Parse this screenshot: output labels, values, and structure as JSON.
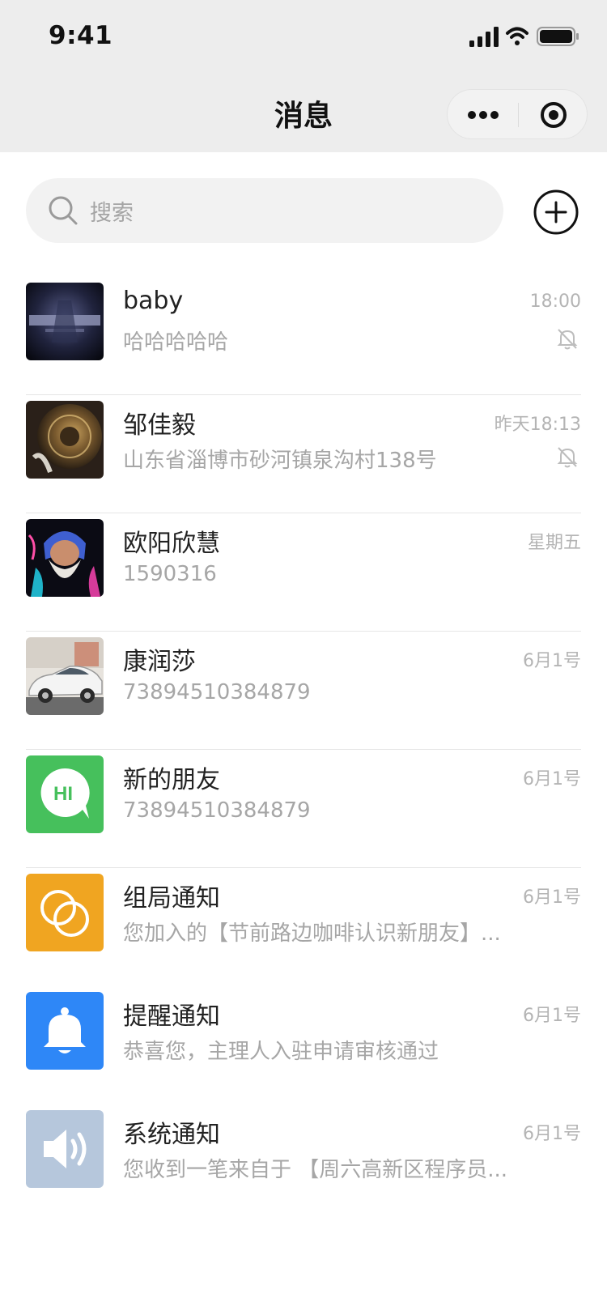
{
  "status_bar": {
    "time": "9:41"
  },
  "nav": {
    "title": "消息",
    "more_icon": "more-dots-icon",
    "close_icon": "target-circle-icon"
  },
  "search": {
    "placeholder": "搜索",
    "icon": "search-icon"
  },
  "add_button": {
    "icon": "plus-circle-icon"
  },
  "conversations": [
    {
      "name": "baby",
      "preview": "哈哈哈哈哈",
      "time": "18:00",
      "muted": true,
      "avatar": "avengers-poster"
    },
    {
      "name": "邹佳毅",
      "preview": "山东省淄博市砂河镇泉沟村138号",
      "time": "昨天18:13",
      "muted": true,
      "avatar": "clockwork-photo"
    },
    {
      "name": "欧阳欣慧",
      "preview": "1590316",
      "time": "星期五",
      "muted": false,
      "avatar": "bearded-portrait"
    },
    {
      "name": "康润莎",
      "preview": "73894510384879",
      "time": "6月1号",
      "muted": false,
      "avatar": "white-car-photo"
    },
    {
      "name": "新的朋友",
      "preview": "73894510384879",
      "time": "6月1号",
      "muted": false,
      "avatar": "hi-bubble",
      "avatar_text": "HI"
    },
    {
      "name": "组局通知",
      "preview": "您加入的【节前路边咖啡认识新朋友】...",
      "time": "6月1号",
      "muted": false,
      "avatar": "rings-icon"
    },
    {
      "name": "提醒通知",
      "preview": "恭喜您，主理人入驻申请审核通过",
      "time": "6月1号",
      "muted": false,
      "avatar": "bell-icon"
    },
    {
      "name": "系统通知",
      "preview": "您收到一笔来自于 【周六高新区程序员...",
      "time": "6月1号",
      "muted": false,
      "avatar": "speaker-icon"
    }
  ],
  "colors": {
    "header_bg": "#ededed",
    "new_friend": "#46c05c",
    "group_notice": "#f0a521",
    "reminder": "#2e87f7",
    "system": "#b6c7dc"
  }
}
